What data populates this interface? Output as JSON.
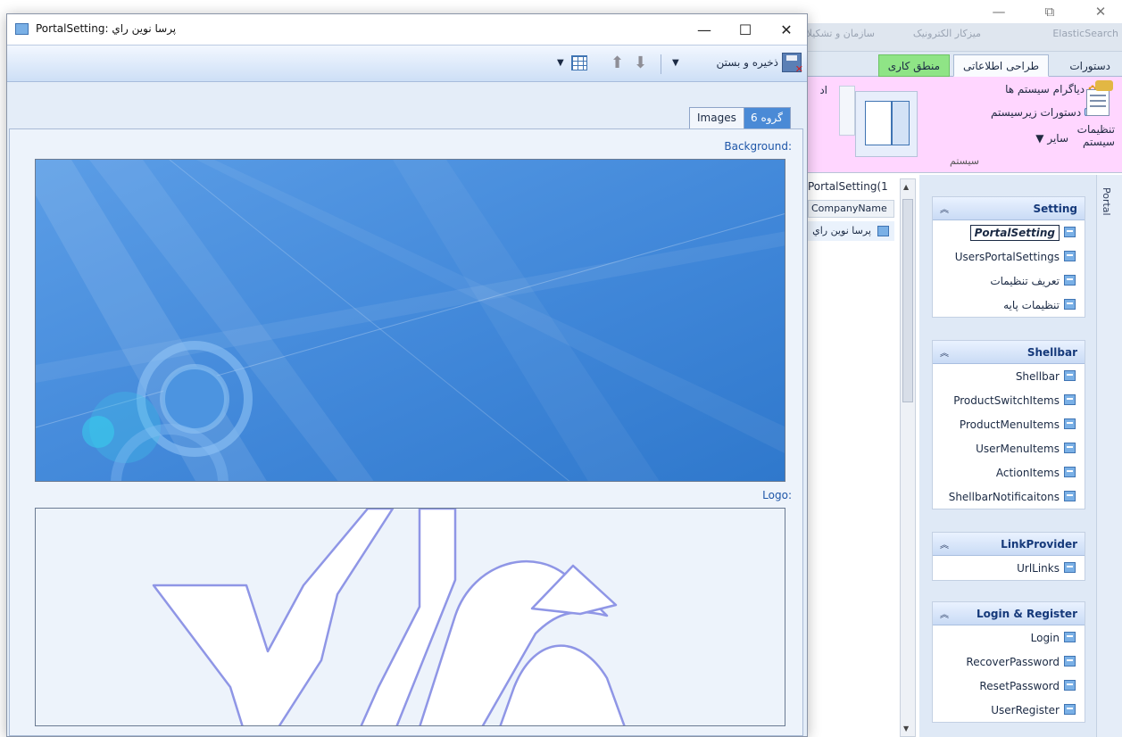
{
  "background_app": {
    "window_controls": {
      "minimize": "—",
      "restore": "⧉",
      "close": "✕"
    },
    "top_tabs": [
      "سازمان و تشکیلات",
      "میزکار الکترونیک",
      "ElasticSearch"
    ],
    "ribbon_tabs": [
      "دستورات",
      "طراحی اطلاعاتی",
      "منطق کاری"
    ],
    "ribbon": {
      "diagram_label": "دیاگرام سیستم ها",
      "subsystem_commands_label": "دستورات زیرسیستم",
      "other_label": "سایر",
      "system_settings_label_1": "تنظیمات",
      "system_settings_label_2": "سیستم",
      "group_label": "سیستم",
      "cut_label": "اد"
    },
    "side_tab_label": "Portal",
    "grid": {
      "title": "PortalSetting(1",
      "column_header": "CompanyName",
      "row_value": "پرسا نوین راي"
    },
    "nav_groups": [
      {
        "title": "Setting",
        "items": [
          "PortalSetting",
          "UsersPortalSettings",
          "تعریف تنظیمات",
          "تنظیمات پایه"
        ]
      },
      {
        "title": "Shellbar",
        "items": [
          "Shellbar",
          "ProductSwitchItems",
          "ProductMenuItems",
          "UserMenuItems",
          "ActionItems",
          "ShellbarNotificaitons"
        ]
      },
      {
        "title": "LinkProvider",
        "items": [
          "UrlLinks"
        ]
      },
      {
        "title": "Login & Register",
        "items": [
          "Login",
          "RecoverPassword",
          "ResetPassword",
          "UserRegister"
        ]
      }
    ],
    "selected_nav_item": "PortalSetting"
  },
  "modal": {
    "title": "PortalSetting: پرسا نوین راي",
    "controls": {
      "minimize": "—",
      "maximize": "☐",
      "close": "✕"
    },
    "toolbar": {
      "save_close_label": "ذخیره و بستن"
    },
    "tabs": [
      {
        "label": "گروه 6",
        "active": true
      },
      {
        "label": "Images",
        "active": false
      }
    ],
    "fields": {
      "background_label": ":Background",
      "logo_label": ":Logo"
    }
  },
  "colors": {
    "accent": "#4a8ad6",
    "ribbon_pink": "#ffd6ff",
    "green_tab": "#8fe486",
    "field_label": "#1e56a8"
  }
}
